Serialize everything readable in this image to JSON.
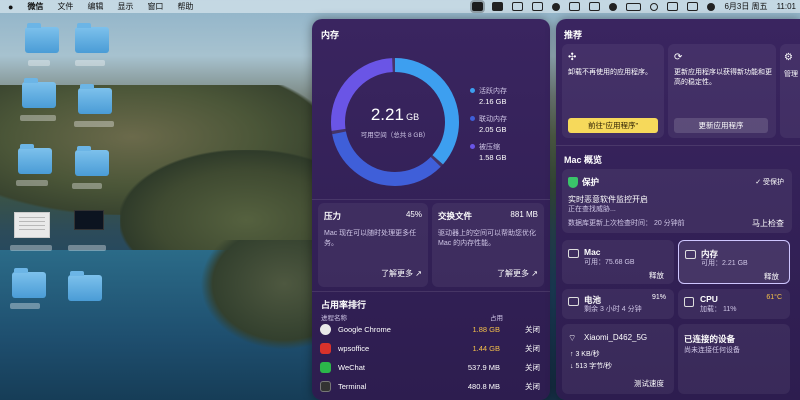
{
  "menubar": {
    "app": "微信",
    "items": [
      "文件",
      "编辑",
      "显示",
      "窗口",
      "帮助"
    ],
    "date_time": "6月3日 周五",
    "clock": "11:01"
  },
  "memory": {
    "title": "内存",
    "value": "2.21",
    "unit": "GB",
    "sub": "可用空间（总共 8 GB）",
    "legend": [
      {
        "name": "活跃内存",
        "value": "2.16 GB",
        "color": "#3d9ff0"
      },
      {
        "name": "联动内存",
        "value": "2.05 GB",
        "color": "#3f5fd9"
      },
      {
        "name": "被压缩",
        "value": "1.58 GB",
        "color": "#6a55e6"
      }
    ]
  },
  "pressure": {
    "title": "压力",
    "value": "45%",
    "desc": "Mac 现在可以随时处理更多任务。",
    "link": "了解更多 ↗"
  },
  "swap": {
    "title": "交换文件",
    "value": "881 MB",
    "desc": "驱动器上的空间可以帮助您优化 Mac 的内存性能。",
    "link": "了解更多 ↗"
  },
  "usage": {
    "title": "占用率排行",
    "header_name": "进程名称",
    "header_mem": "占用",
    "processes": [
      {
        "name": "Google Chrome",
        "mem": "1.88 GB",
        "action": "关闭",
        "color": "#e9e9e9",
        "warn": true
      },
      {
        "name": "wpsoffice",
        "mem": "1.44 GB",
        "action": "关闭",
        "color": "#d9322b",
        "warn": true
      },
      {
        "name": "WeChat",
        "mem": "537.9 MB",
        "action": "关闭",
        "color": "#2bb74a",
        "warn": false
      },
      {
        "name": "Terminal",
        "mem": "480.8 MB",
        "action": "关闭",
        "color": "#333333",
        "warn": false
      }
    ]
  },
  "recommend": {
    "title": "推荐",
    "card1_text": "卸载不再使用的应用程序。",
    "card1_btn": "前往“应用程序”",
    "card2_text": "更新应用程序以获得新功能和更高的稳定性。",
    "card2_btn": "更新应用程序",
    "card3_text": "管理"
  },
  "overview": {
    "title": "Mac 概览",
    "protect": "保护",
    "protect_status": "受保护",
    "realtime": "实时恶意软件监控开启",
    "searching": "正在查找威胁...",
    "db_update": "数据库更新上次检查时间： 20 分钟前",
    "check_btn": "马上检查",
    "disk_name": "Mac",
    "disk_avail": "可用：75.68 GB",
    "disk_btn": "释放",
    "mem_name": "内存",
    "mem_avail": "可用：2.21 GB",
    "mem_btn": "释放",
    "battery_name": "电池",
    "battery_pct": "91%",
    "battery_desc": "剩余 3 小时 4 分钟",
    "cpu_name": "CPU",
    "cpu_temp": "61°C",
    "cpu_load": "加载： 11%",
    "wifi_name": "Xiaomi_D462_5G",
    "wifi_up": "3 KB/秒",
    "wifi_down": "513 字节/秒",
    "wifi_btn": "测试速度",
    "devices_title": "已连接的设备",
    "devices_desc": "尚未连接任何设备"
  }
}
